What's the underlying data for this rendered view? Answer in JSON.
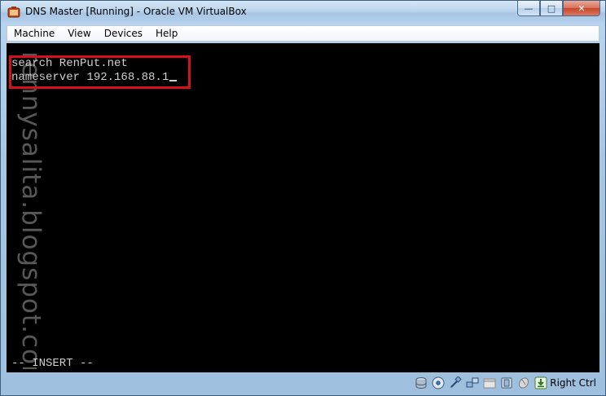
{
  "window": {
    "title": "DNS Master [Running] - Oracle VM VirtualBox"
  },
  "menubar": {
    "items": [
      "Machine",
      "View",
      "Devices",
      "Help"
    ]
  },
  "terminal": {
    "lines": [
      "search RenPut.net",
      "nameserver 192.168.88.1"
    ],
    "mode_line": "-- INSERT --",
    "highlight_color": "#d4101a"
  },
  "watermark": {
    "text": "rennysalita.blogspot.com"
  },
  "statusbar": {
    "icons": [
      "hard-disk-icon",
      "optical-drive-icon",
      "usb-icon",
      "network-icon",
      "shared-folders-icon",
      "display-icon",
      "mouse-integration-icon",
      "host-key-arrow-icon"
    ],
    "host_key_label": "Right Ctrl"
  },
  "caption_buttons": {
    "minimize": "—",
    "maximize": "□",
    "close": "✕"
  }
}
